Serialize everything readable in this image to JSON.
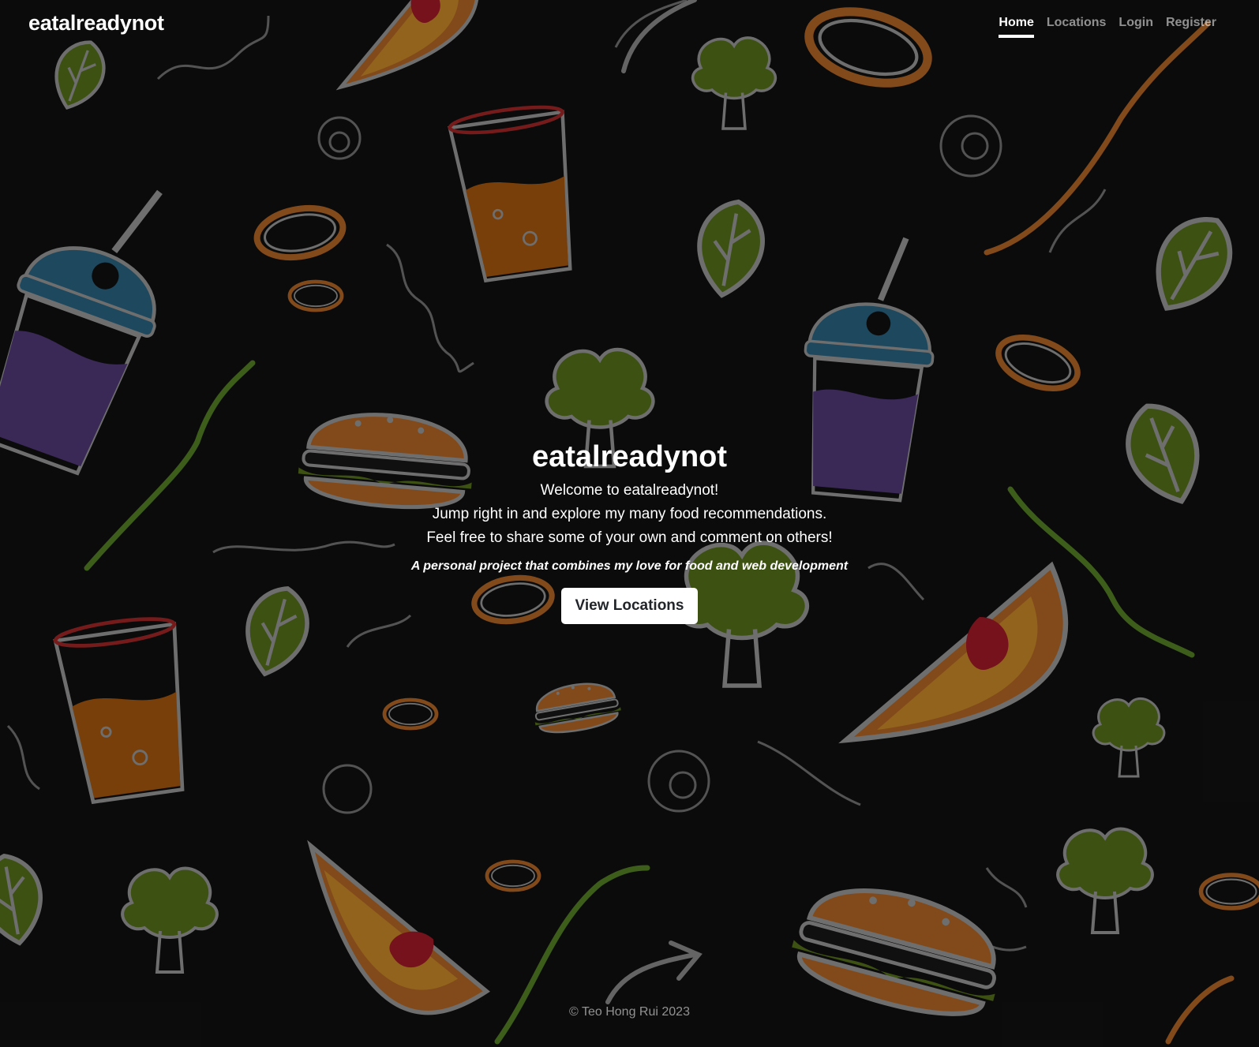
{
  "navbar": {
    "brand": "eatalreadynot",
    "links": [
      {
        "label": "Home",
        "active": true
      },
      {
        "label": "Locations",
        "active": false
      },
      {
        "label": "Login",
        "active": false
      },
      {
        "label": "Register",
        "active": false
      }
    ]
  },
  "hero": {
    "title": "eatalreadynot",
    "lines": [
      "Welcome to eatalreadynot!",
      "Jump right in and explore my many food recommendations.",
      "Feel free to share some of your own and comment on others!"
    ],
    "tagline": "A personal project that combines my love for food and web development",
    "cta_label": "View Locations"
  },
  "footer": {
    "copyright": "© Teo Hong Rui 2023"
  },
  "theme": {
    "background": "#121212",
    "text": "#ffffff",
    "muted_text": "rgba(255,255,255,0.55)",
    "button_bg": "#ffffff",
    "button_text": "#212529",
    "doodle_colors": [
      "#7a9a2c",
      "#c8722a",
      "#2f7fa3",
      "#6a4a9a",
      "#b52a2a",
      "#9a9a9a"
    ]
  },
  "background_icons": [
    "burger-icon",
    "drink-cup-icon",
    "iced-drink-icon",
    "pizza-slice-icon",
    "onion-ring-icon",
    "leaf-icon",
    "broccoli-icon",
    "squiggle-icon",
    "swirl-icon"
  ]
}
